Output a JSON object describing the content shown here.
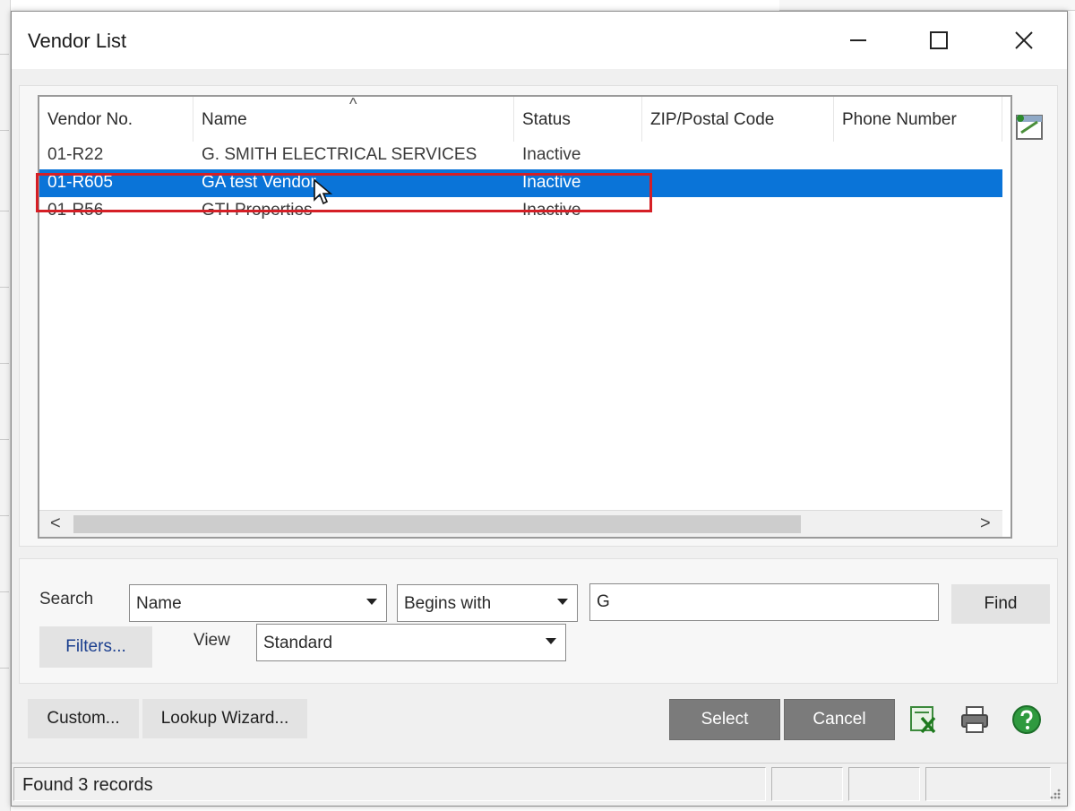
{
  "window": {
    "title": "Vendor List",
    "controls": {
      "minimize": "minimize",
      "maximize": "maximize",
      "close": "close"
    }
  },
  "list": {
    "columns": [
      "Vendor No.",
      "Name",
      "Status",
      "ZIP/Postal Code",
      "Phone Number"
    ],
    "sort_indicator": "^",
    "rows": [
      {
        "vendor_no": "01-R22",
        "name": "G. SMITH ELECTRICAL SERVICES",
        "status": "Inactive",
        "selected": false
      },
      {
        "vendor_no": "01-R605",
        "name": "GA test Vendor",
        "status": "Inactive",
        "selected": true
      },
      {
        "vendor_no": "01-R56",
        "name": "GTI Properties",
        "status": "Inactive",
        "selected": false
      }
    ],
    "scroll_left": "<",
    "scroll_right": ">"
  },
  "search": {
    "label": "Search",
    "field": "Name",
    "operator": "Begins with",
    "value": "G",
    "find_label": "Find",
    "filters_label": "Filters...",
    "view_label": "View",
    "view_value": "Standard"
  },
  "footer": {
    "custom_label": "Custom...",
    "lookup_wizard_label": "Lookup Wizard...",
    "select_label": "Select",
    "cancel_label": "Cancel",
    "icons": [
      "excel-export-icon",
      "print-icon",
      "help-icon"
    ]
  },
  "status": {
    "text": "Found 3 records"
  },
  "colors": {
    "selection": "#0a74d8",
    "highlight": "#d51f26",
    "dark_button": "#7b7b7b"
  }
}
